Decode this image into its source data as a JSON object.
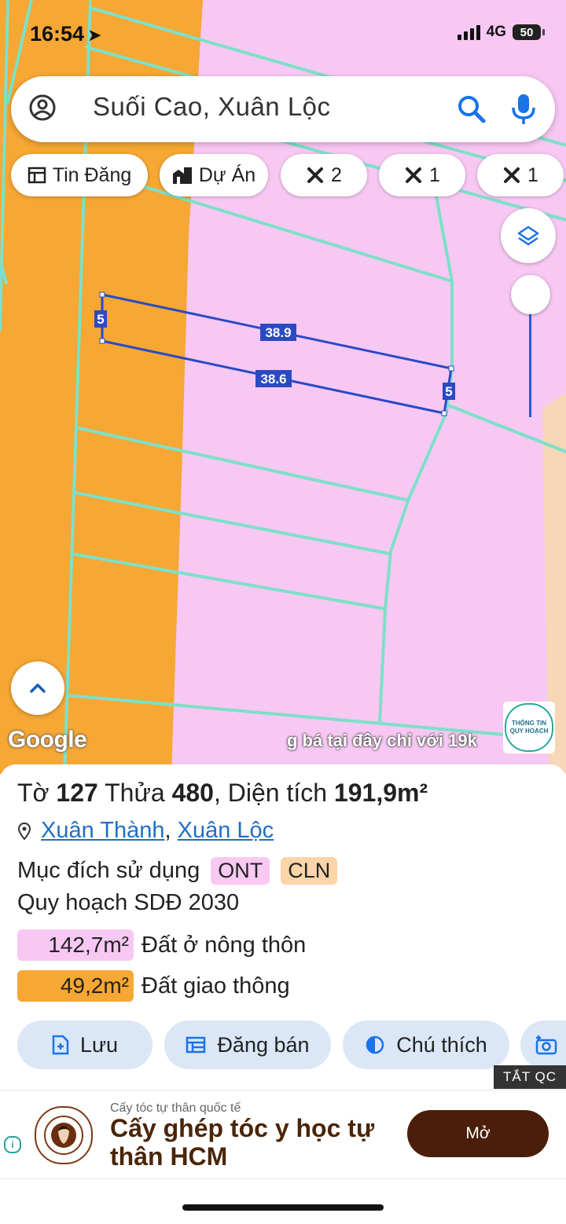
{
  "status_bar": {
    "time": "16:54",
    "network": "4G",
    "battery": "50"
  },
  "search": {
    "text": "Suối Cao, Xuân Lộc"
  },
  "filter_chips": [
    {
      "label": "Tin Đăng",
      "icon": "table-icon"
    },
    {
      "label": "Dự Án",
      "icon": "buildings-icon"
    },
    {
      "label": "2",
      "icon": "tools-icon"
    },
    {
      "label": "1",
      "icon": "tools-icon"
    },
    {
      "label": "1",
      "icon": "tools-icon"
    }
  ],
  "map": {
    "measurements": {
      "top": "38.9",
      "bottom": "38.6",
      "left": "5",
      "right": "5"
    },
    "attribution": "Google",
    "banner_text": "g bá tại đây chỉ với 19k",
    "planning_badge": {
      "line1": "THÔNG TIN",
      "line2": "QUY HOẠCH"
    },
    "colors": {
      "residential": "#f8c8f4",
      "traffic": "#f6a734",
      "parcel_line": "#7de0c8",
      "measure_line": "#2a4ac4"
    }
  },
  "parcel": {
    "to_label": "Tờ",
    "to_value": "127",
    "thua_label": "Thửa",
    "thua_value": "480",
    "area_label": "Diện tích",
    "area_value": "191,9m²",
    "ward": "Xuân Thành",
    "district": "Xuân Lộc",
    "purpose_label": "Mục đích sử dụng",
    "purpose_tags": [
      {
        "code": "ONT",
        "color": "#f9c9f2"
      },
      {
        "code": "CLN",
        "color": "#fbd4a8"
      }
    ],
    "plan_label": "Quy hoạch SDĐ 2030",
    "areas": [
      {
        "value": "142,7m²",
        "label": "Đất ở nông thôn",
        "color": "#f8c8f4"
      },
      {
        "value": "49,2m²",
        "label": "Đất giao thông",
        "color": "#f6a734"
      }
    ]
  },
  "actions": {
    "save": "Lưu",
    "post_sale": "Đăng bán",
    "legend": "Chú thích"
  },
  "ad": {
    "close_label": "TẮT QC",
    "small": "Cấy tóc tự thân quốc tế",
    "headline": "Cấy ghép tóc y học tự thân HCM",
    "cta": "Mở"
  }
}
